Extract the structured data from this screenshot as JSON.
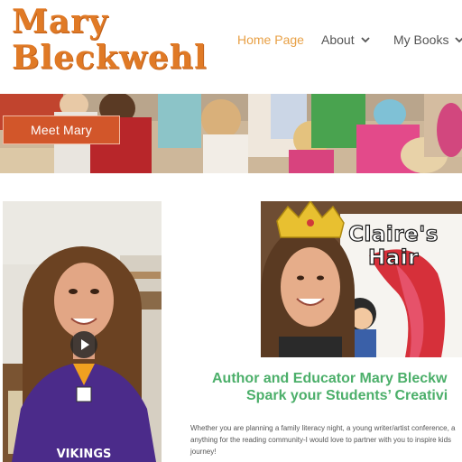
{
  "site": {
    "logo_line1": "Mary",
    "logo_line2": "Bleckwehl"
  },
  "nav": {
    "items": [
      {
        "label": "Home Page",
        "active": true,
        "dropdown": false
      },
      {
        "label": "About",
        "active": false,
        "dropdown": true
      },
      {
        "label": "My Books",
        "active": false,
        "dropdown": true
      }
    ]
  },
  "hero": {
    "button_label": "Meet Mary"
  },
  "video": {
    "shirt_text": "VIKINGS",
    "play_icon": "play-icon"
  },
  "book": {
    "title_line1": "Claire's",
    "title_line2": "Hair"
  },
  "content": {
    "headline_line1": "Author and Educator Mary Bleckw",
    "headline_line2": "Spark your Students’ Creativi",
    "paragraph": "Whether you are planning a family literacy night, a young writer/artist conference, a anything for the reading community-I would love to partner with you to inspire kids journey!"
  },
  "colors": {
    "logo": "#e07a26",
    "nav_active": "#e8a045",
    "nav_default": "#555555",
    "button": "#d2562a",
    "headline": "#4caf6a"
  }
}
